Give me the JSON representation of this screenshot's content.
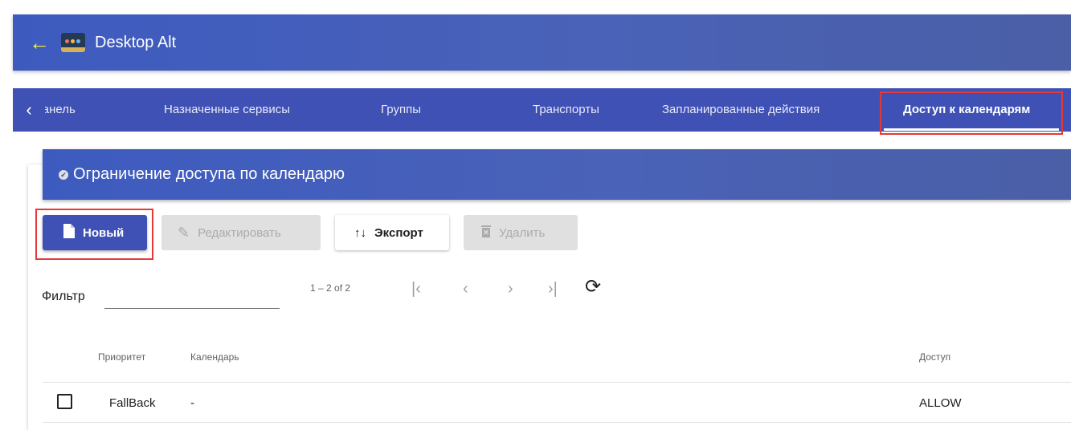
{
  "app": {
    "title": "Desktop Alt",
    "back_icon": "arrow-left-icon",
    "icon": "desktop-alt-icon"
  },
  "tabs": {
    "items": [
      {
        "label": "Панель"
      },
      {
        "label": "Назначенные сервисы"
      },
      {
        "label": "Группы"
      },
      {
        "label": "Транспорты"
      },
      {
        "label": "Запланированные действия"
      },
      {
        "label": "Доступ к календарям"
      }
    ],
    "active_index": 5
  },
  "card": {
    "title": "Ограничение доступа по календарю"
  },
  "toolbar": {
    "new_label": "Новый",
    "edit_label": "Редактировать",
    "export_label": "Экспорт",
    "delete_label": "Удалить"
  },
  "filter": {
    "label": "Фильтр",
    "value": ""
  },
  "pagination": {
    "range": "1 – 2 of 2"
  },
  "table": {
    "columns": {
      "priority": "Приоритет",
      "calendar": "Календарь",
      "access": "Доступ"
    },
    "rows": [
      {
        "priority": "FallBack",
        "calendar": "-",
        "access": "ALLOW"
      }
    ]
  },
  "colors": {
    "primary": "#3f51b5",
    "highlight": "#e53935",
    "accent_arrow": "#ffeb3b"
  }
}
